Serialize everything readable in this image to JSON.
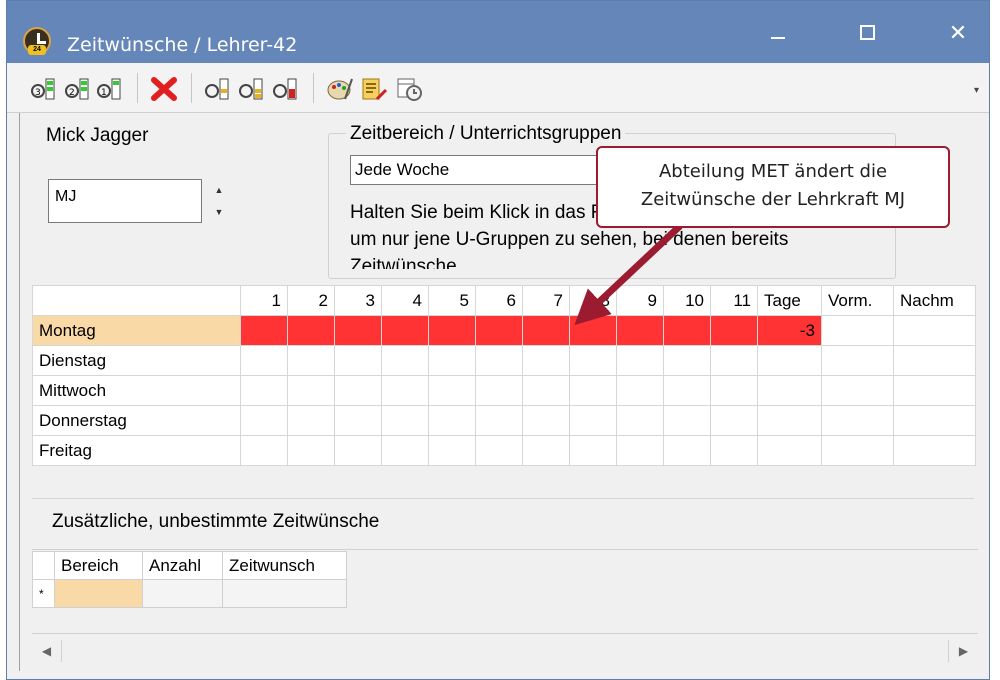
{
  "window": {
    "title": "Zeitwünsche / Lehrer-42",
    "minimize_icon": "minimize-icon",
    "maximize_icon": "maximize-icon",
    "close_glyph": "✕"
  },
  "toolbar": {
    "chevron": "▾",
    "icons": [
      "copy-3-icon",
      "copy-2-icon",
      "copy-1-icon",
      "delete-icon",
      "paste-1-icon",
      "paste-2-icon",
      "paste-3-icon",
      "palette-icon",
      "list-edit-icon",
      "calendar-clock-icon"
    ]
  },
  "teacher": {
    "name": "Mick Jagger",
    "code": "MJ",
    "spin_up": "▲",
    "spin_down": "▼"
  },
  "range": {
    "title": "Zeitbereich / Unterrichtsgruppen",
    "value": "Jede Woche",
    "hint": "Halten Sie beim Klick in das Feld oben die Strg-Taste gedrückt, um nur jene U-Gruppen zu sehen, bei denen bereits Zeitwünsche"
  },
  "grid": {
    "periods": [
      "1",
      "2",
      "3",
      "4",
      "5",
      "6",
      "7",
      "8",
      "9",
      "10",
      "11"
    ],
    "extra_headers": [
      "Tage",
      "Vorm.",
      "Nachm"
    ],
    "days": [
      {
        "name": "Montag",
        "selected": true,
        "red": true,
        "tage": "-3",
        "vorm": "",
        "nachm": ""
      },
      {
        "name": "Dienstag",
        "selected": false,
        "red": false,
        "tage": "",
        "vorm": "",
        "nachm": ""
      },
      {
        "name": "Mittwoch",
        "selected": false,
        "red": false,
        "tage": "",
        "vorm": "",
        "nachm": ""
      },
      {
        "name": "Donnerstag",
        "selected": false,
        "red": false,
        "tage": "",
        "vorm": "",
        "nachm": ""
      },
      {
        "name": "Freitag",
        "selected": false,
        "red": false,
        "tage": "",
        "vorm": "",
        "nachm": ""
      }
    ]
  },
  "extra": {
    "title": "Zusätzliche, unbestimmte Zeitwünsche",
    "headers": [
      "Bereich",
      "Anzahl",
      "Zeitwunsch"
    ],
    "new_row_marker": "*"
  },
  "scroll": {
    "left": "◀",
    "right": "▶"
  },
  "callout": {
    "text": "Abteilung MET ändert die Zeitwünsche der Lehrkraft MJ"
  },
  "colors": {
    "titlebar": "#6586b8",
    "red_cell": "#ff3333",
    "selected_day": "#f9d9a6",
    "callout_border": "#9b1b30"
  }
}
